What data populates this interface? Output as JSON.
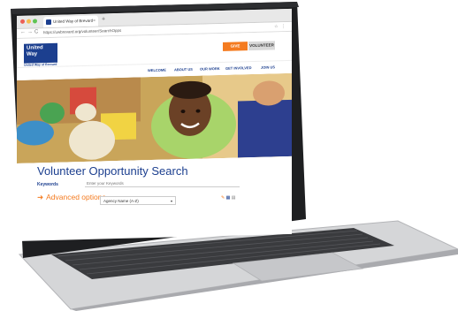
{
  "browser": {
    "tab_title": "United Way of Brevard",
    "tab_close": "×",
    "new_tab": "+",
    "back": "←",
    "forward": "→",
    "reload": "C",
    "url": "https://uwbrevard.org/volunteer/SearchOpps",
    "address_icons": "☆ ⋮"
  },
  "site": {
    "logo_line1": "United",
    "logo_line2": "Way",
    "logo_sub": "United Way of Brevard",
    "give_button": "GIVE",
    "volunteer_button": "VOLUNTEER",
    "nav": [
      "WELCOME",
      "ABOUT US",
      "OUR WORK",
      "GET INVOLVED",
      "JOIN US"
    ]
  },
  "search": {
    "title": "Volunteer Opportunity Search",
    "keywords_label": "Keywords",
    "keywords_placeholder": "Enter your Keywords",
    "advanced_arrow": "➜",
    "advanced_label": "Advanced options",
    "sort_value": "Agency Name (A-Z)",
    "sort_caret": "▾",
    "view_icons": [
      "✎",
      "▦",
      "▤"
    ]
  },
  "colors": {
    "brand_blue": "#1c3f8f",
    "accent_orange": "#f47b20"
  }
}
